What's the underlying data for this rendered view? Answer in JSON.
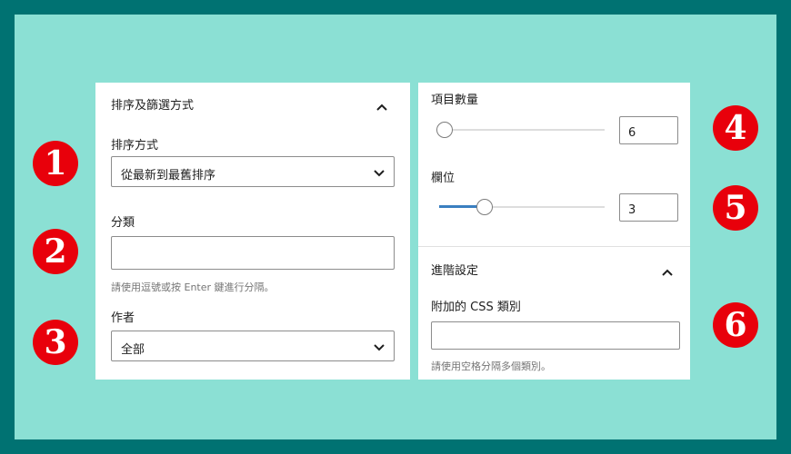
{
  "left_panel": {
    "section_title": "排序及篩選方式",
    "order_label": "排序方式",
    "order_value": "從最新到最舊排序",
    "category_label": "分類",
    "category_value": "",
    "category_help": "請使用逗號或按 Enter 鍵進行分隔。",
    "author_label": "作者",
    "author_value": "全部"
  },
  "right_panel": {
    "items_label": "項目數量",
    "items_value": "6",
    "items_slider_fraction": 0.0,
    "columns_label": "欄位",
    "columns_value": "3",
    "columns_slider_fraction": 0.25,
    "advanced_title": "進階設定",
    "css_label": "附加的 CSS 類別",
    "css_value": "",
    "css_help": "請使用空格分隔多個類別。"
  },
  "badges": [
    "1",
    "2",
    "3",
    "4",
    "5",
    "6"
  ],
  "colors": {
    "outer_border": "#007272",
    "background": "#8be0d4",
    "badge": "#e8000b",
    "slider_fill": "#3a7fc0"
  },
  "icons": [
    "chevron-up-icon",
    "chevron-down-icon"
  ]
}
